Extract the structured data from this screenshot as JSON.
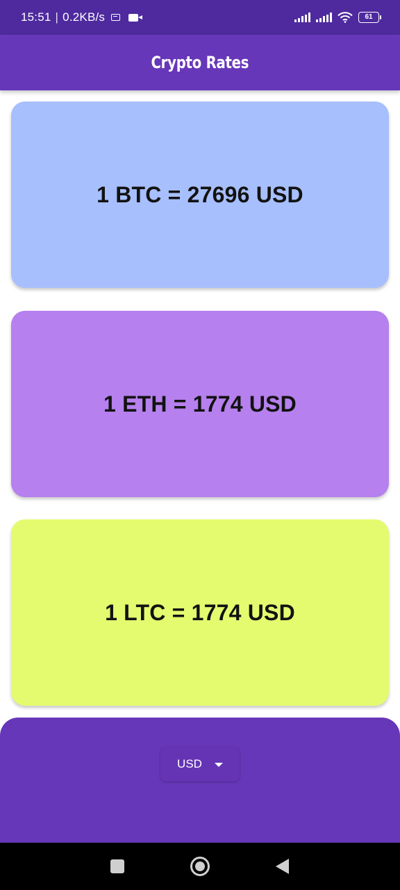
{
  "status_bar": {
    "time": "15:51",
    "separator": "|",
    "speed": "0.2KB/s",
    "battery_level": "61",
    "icons": [
      "notification-icon",
      "screen-record-icon",
      "signal-icon",
      "signal-icon",
      "wifi-icon",
      "battery-icon"
    ]
  },
  "app_bar": {
    "title": "Crypto Rates"
  },
  "rates": [
    {
      "text": "1 BTC = 27696 USD",
      "color": "#a7bffd"
    },
    {
      "text": "1 ETH = 1774 USD",
      "color": "#b680ee"
    },
    {
      "text": "1 LTC = 1774 USD",
      "color": "#e4fb70"
    }
  ],
  "currency_selector": {
    "selected": "USD",
    "icon": "dropdown-arrow-icon"
  },
  "navigation_bar": {
    "icons": [
      "recent-apps-icon",
      "home-icon",
      "back-icon"
    ]
  },
  "colors": {
    "status_bar": "#4e2a9e",
    "primary": "#6737b9",
    "nav_bar": "#000000"
  }
}
